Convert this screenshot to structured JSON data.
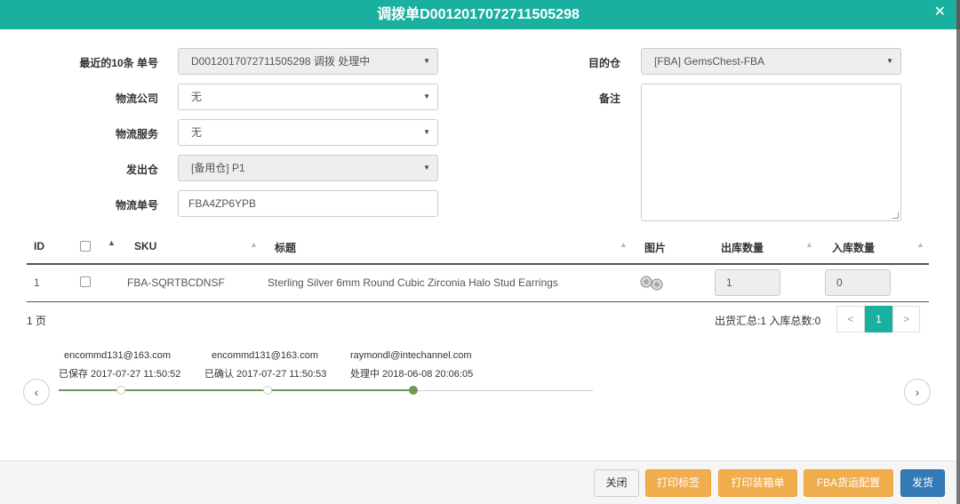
{
  "title": "调拨单D0012017072711505298",
  "form": {
    "recent_label": "最近的10条 单号",
    "recent_value": "D0012017072711505298 调拨 处理中",
    "logistics_company_label": "物流公司",
    "logistics_company_value": "无",
    "logistics_service_label": "物流服务",
    "logistics_service_value": "无",
    "origin_label": "发出仓",
    "origin_value": "[备用仓] P1",
    "tracking_label": "物流单号",
    "tracking_value": "FBA4ZP6YPB",
    "destination_label": "目的仓",
    "destination_value": "[FBA] GemsChest-FBA",
    "remark_label": "备注",
    "remark_value": ""
  },
  "table": {
    "headers": {
      "id": "ID",
      "sku": "SKU",
      "title": "标题",
      "image": "图片",
      "out_qty": "出库数量",
      "in_qty": "入库数量"
    },
    "rows": [
      {
        "id": "1",
        "sku": "FBA-SQRTBCDNSF",
        "title": "Sterling Silver 6mm Round Cubic Zirconia Halo Stud Earrings",
        "out_qty": "1",
        "in_qty": "0"
      }
    ]
  },
  "pagination": {
    "pages_text": "1 页",
    "summary": "出货汇总:1 入库总数:0",
    "prev": "<",
    "current": "1",
    "next": ">"
  },
  "timeline": {
    "events": [
      {
        "user": "encommd131@163.com",
        "status": "已保存 2017-07-27 11:50:52"
      },
      {
        "user": "encommd131@163.com",
        "status": "已确认 2017-07-27 11:50:53"
      },
      {
        "user": "raymondl@intechannel.com",
        "status": "处理中 2018-06-08 20:06:05"
      }
    ],
    "prev": "‹",
    "next": "›"
  },
  "buttons": {
    "close": "关闭",
    "print_label": "打印标签",
    "print_packing": "打印装箱单",
    "fba_config": "FBA货运配置",
    "ship": "发货"
  },
  "colors": {
    "header": "#1ab0a0",
    "warning": "#f0ad4e",
    "primary": "#337ab7",
    "timeline_active": "#6a9a5a"
  }
}
